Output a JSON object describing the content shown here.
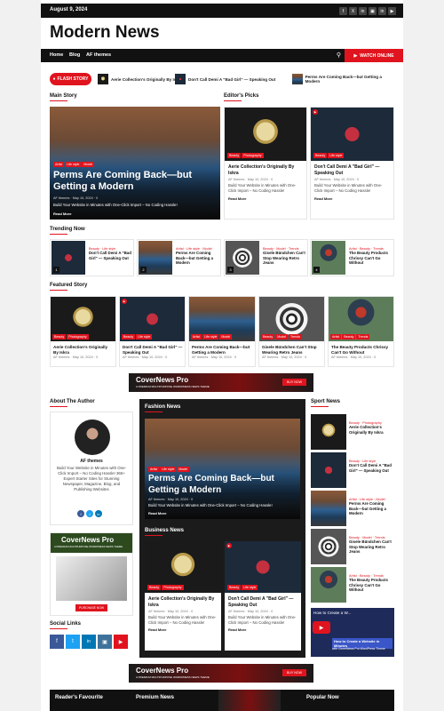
{
  "topbar": {
    "date": "August 9, 2024",
    "social": [
      "f",
      "X",
      "in",
      "▣",
      "in",
      "▶"
    ]
  },
  "site": {
    "title": "Modern News"
  },
  "nav": {
    "items": [
      "Home",
      "Blog",
      "AF themes"
    ],
    "watch": "WATCH ONLINE"
  },
  "flash": {
    "label": "FLASH STORY",
    "items": [
      "Aerie Collection's Originally By Iskra",
      "Don't Call Demi A \"Bad Girl\" — Speaking Out",
      "Perms Are Coming Back—but Getting a Modern"
    ]
  },
  "main_story": {
    "heading": "Main Story",
    "cats": [
      "Artist",
      "Life style",
      "Model"
    ],
    "title": "Perms Are Coming Back—but Getting a Modern",
    "author": "AF themes",
    "date": "May 10, 2024",
    "comments": "0",
    "excerpt": "Build Your Website in Minutes with One-Click Import – No Coding Hassle!",
    "read_more": "Read More"
  },
  "editors": {
    "heading": "Editor's Picks",
    "items": [
      {
        "cats": [
          "Beauty",
          "Photography"
        ],
        "title": "Aerie Collection's Originally By Iskra",
        "author": "AF themes",
        "date": "May 10, 2024",
        "comments": "0",
        "excerpt": "Build Your Website in Minutes with One-Click Import – No Coding Hassle!",
        "read_more": "Read More"
      },
      {
        "cats": [
          "Beauty",
          "Life style"
        ],
        "title": "Don't Call Demi A \"Bad Girl\" — Speaking Out",
        "author": "AF themes",
        "date": "May 10, 2024",
        "comments": "0",
        "excerpt": "Build Your Website in Minutes with One-Click Import – No Coding Hassle!",
        "read_more": "Read More"
      }
    ]
  },
  "trending": {
    "heading": "Trending Now",
    "items": [
      {
        "n": "1",
        "cats": "Beauty · Life style",
        "title": "Don't Call Demi A \"Bad Girl\" — Speaking Out"
      },
      {
        "n": "2",
        "cats": "Artist · Life style · Model",
        "title": "Perms Are Coming Back—but Getting a Modern"
      },
      {
        "n": "3",
        "cats": "Beauty · Model · Trends",
        "title": "Gisele Bündchen Can't Stop Wearing Retro Jeans"
      },
      {
        "n": "4",
        "cats": "Artist · Beauty · Trends",
        "title": "The Beauty Products Chrissy Can't Go Without"
      }
    ]
  },
  "featured": {
    "heading": "Featured Story",
    "items": [
      {
        "cats": [
          "Beauty",
          "Photography"
        ],
        "title": "Aerie Collection's Originally By Iskra",
        "author": "AF themes",
        "date": "May 10, 2024",
        "comments": "0"
      },
      {
        "cats": [
          "Beauty",
          "Life style"
        ],
        "title": "Don't Call Demi A \"Bad Girl\" — Speaking Out",
        "author": "AF themes",
        "date": "May 10, 2024",
        "comments": "0"
      },
      {
        "cats": [
          "Artist",
          "Life style",
          "Model"
        ],
        "title": "Perms Are Coming Back—but Getting a Modern",
        "author": "AF themes",
        "date": "May 10, 2024",
        "comments": "0"
      },
      {
        "cats": [
          "Beauty",
          "Model",
          "Trends"
        ],
        "title": "Gisele Bündchen Can't Stop Wearing Retro Jeans",
        "author": "AF themes",
        "date": "May 10, 2024",
        "comments": "0"
      },
      {
        "cats": [
          "Artist",
          "Beauty",
          "Trends"
        ],
        "title": "The Beauty Products Chrissy Can't Go Without",
        "author": "AF themes",
        "date": "May 10, 2024",
        "comments": "0"
      }
    ]
  },
  "ad": {
    "title": "CoverNews Pro",
    "sub": "A PREMIUM MULTIPURPOSE WORDPRESS NEWS THEME",
    "cta": "BUY NOW"
  },
  "author": {
    "heading": "About The Author",
    "name": "AF themes",
    "bio": "Build Your Website in Minutes with One-Click Import – No Coding Hassle! 365+ Expert Starter Sites for Stunning Newspaper, Magazine, Blog, and Publishing Websites"
  },
  "side_ad": {
    "title": "CoverNews Pro",
    "sub": "A PREMIUM MULTIPURPOSE WORDPRESS NEWS THEME",
    "cta": "PURCHASE NOW"
  },
  "social_links": {
    "heading": "Social Links"
  },
  "fashion": {
    "heading": "Fashion News",
    "cats": [
      "Artist",
      "Life style",
      "Model"
    ],
    "title": "Perms Are Coming Back—but Getting a Modern",
    "author": "AF themes",
    "date": "May 10, 2024",
    "comments": "0",
    "excerpt": "Build Your Website in Minutes with One-Click Import – No Coding Hassle!",
    "read_more": "Read More"
  },
  "business": {
    "heading": "Business News",
    "items": [
      {
        "cats": [
          "Beauty",
          "Photography"
        ],
        "title": "Aerie Collection's Originally By Iskra",
        "author": "AF themes",
        "date": "May 10, 2024",
        "comments": "0",
        "excerpt": "Build Your Website in Minutes with One-Click Import – No Coding Hassle!",
        "read_more": "Read More"
      },
      {
        "cats": [
          "Beauty",
          "Life style"
        ],
        "title": "Don't Call Demi A \"Bad Girl\" — Speaking Out",
        "author": "AF themes",
        "date": "May 10, 2024",
        "comments": "0",
        "excerpt": "Build Your Website in Minutes with One-Click Import – No Coding Hassle!",
        "read_more": "Read More"
      }
    ]
  },
  "sport": {
    "heading": "Sport News",
    "items": [
      {
        "cats": "Beauty · Photography",
        "title": "Aerie Collection's Originally By Iskra"
      },
      {
        "cats": "Beauty · Life style",
        "title": "Don't Call Demi A \"Bad Girl\" — Speaking Out"
      },
      {
        "cats": "Artist · Life style · Model",
        "title": "Perms Are Coming Back—but Getting a Modern"
      },
      {
        "cats": "Beauty · Model · Trends",
        "title": "Gisele Bündchen Can't Stop Wearing Retro Jeans"
      },
      {
        "cats": "Artist · Beauty · Trends",
        "title": "The Beauty Products Chrissy Can't Go Without"
      }
    ]
  },
  "video": {
    "title": "How to Create a W...",
    "caption": "How to Create a Website in Minutes",
    "sub": "with CoverNews Pro WordPress Theme"
  },
  "footer": {
    "readers": "Reader's Favourite",
    "premium": "Premium News",
    "popular": "Popular Now"
  }
}
